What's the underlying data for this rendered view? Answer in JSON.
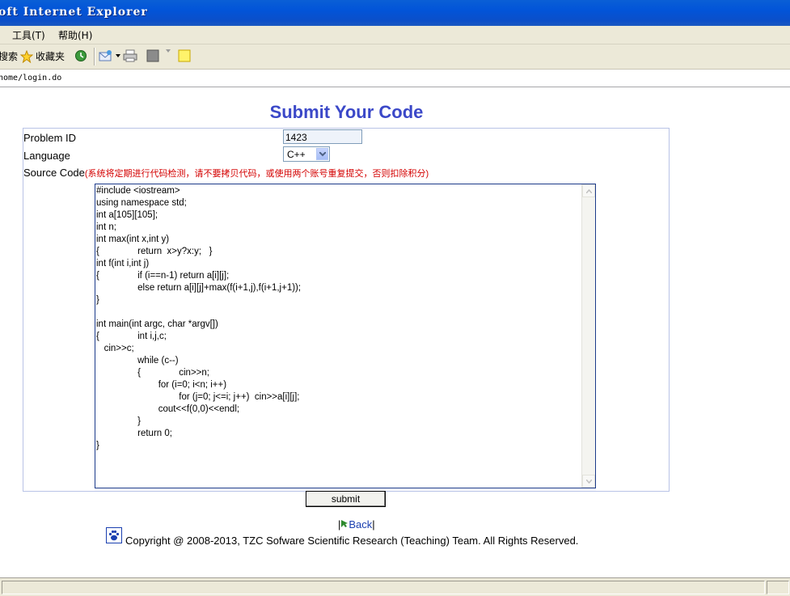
{
  "window": {
    "title": "oft Internet Explorer"
  },
  "menu": {
    "items": [
      "工具(T)",
      "帮助(H)"
    ]
  },
  "toolbar": {
    "search_label": "搜索",
    "favorites_label": "收藏夹"
  },
  "address": {
    "url": "home/login.do"
  },
  "page": {
    "title": "Submit Your Code"
  },
  "form": {
    "problem_id_label": "Problem ID",
    "problem_id_value": "1423",
    "language_label": "Language",
    "language_value": "C++",
    "source_label": "Source Code",
    "source_notice": "(系统将定期进行代码检测，请不要拷贝代码，或使用两个账号重复提交，否则扣除积分)",
    "code": "#include <iostream>\nusing namespace std;\nint a[105][105];\nint n;\nint max(int x,int y)\n{\t\treturn  x>y?x:y;   }\nint f(int i,int j)\n{\t\tif (i==n-1) return a[i][j];\n\t\telse return a[i][j]+max(f(i+1,j),f(i+1,j+1));\n}\n\nint main(int argc, char *argv[])\n{\t\tint i,j,c;\n   cin>>c;\n\t\twhile (c--)\n\t\t{\t\tcin>>n;\n\t\t\tfor (i=0; i<n; i++)\n\t\t\t\tfor (j=0; j<=i; j++)  cin>>a[i][j];\n\t\t\tcout<<f(0,0)<<endl;\n\t\t}\n\t\treturn 0;\n}",
    "submit_label": "submit"
  },
  "nav": {
    "back_prefix": "|",
    "back_label": "Back",
    "back_suffix": "|"
  },
  "footer": {
    "copyright": "Copyright @ 2008-2013, TZC Sofware Scientific Research (Teaching) Team. All Rights Reserved."
  },
  "colors": {
    "accent": "#3b48c8",
    "notice": "#d40000",
    "titlebar": "#0254d8"
  }
}
